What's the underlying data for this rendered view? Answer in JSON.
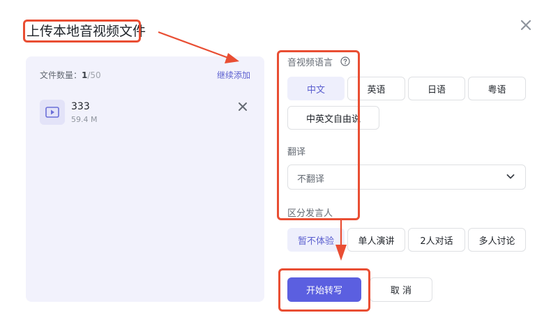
{
  "dialog": {
    "title": "上传本地音视频文件",
    "close_icon": "close-icon"
  },
  "files": {
    "count_label": "文件数量：",
    "count": "1",
    "total": "/50",
    "add_more_label": "继续添加",
    "items": [
      {
        "name": "333",
        "size": "59.4 M",
        "icon": "video-play-icon"
      }
    ]
  },
  "language": {
    "label": "音视频语言",
    "help_icon": "question-circle-icon",
    "options": [
      "中文",
      "英语",
      "日语",
      "粤语",
      "中英文自由说"
    ],
    "selected": "中文"
  },
  "translate": {
    "label": "翻译",
    "value": "不翻译",
    "chevron_icon": "chevron-down-icon"
  },
  "speakers": {
    "label": "区分发言人",
    "options": [
      "暂不体验",
      "单人演讲",
      "2人对话",
      "多人讨论"
    ],
    "selected": "暂不体验"
  },
  "actions": {
    "start_label": "开始转写",
    "cancel_label": "取 消"
  },
  "colors": {
    "accent": "#5b5fe0",
    "annotation": "#e94e33",
    "panel_bg": "#f2f2fc"
  }
}
